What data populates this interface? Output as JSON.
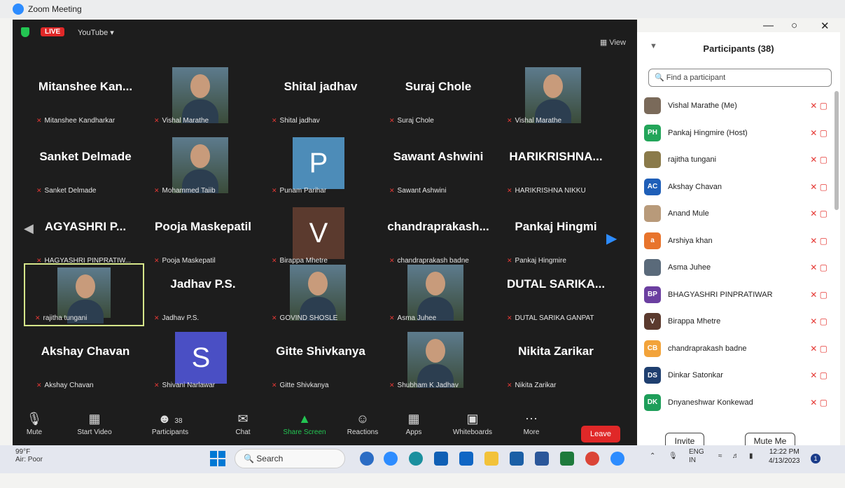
{
  "window": {
    "title": "Zoom Meeting"
  },
  "meeting_top": {
    "live_label": "LIVE",
    "platform": "YouTube",
    "view_label": "View"
  },
  "tiles": [
    {
      "big": "Mitanshee Kan...",
      "name": "Mitanshee Kandharkar"
    },
    {
      "photo": true,
      "name": "Vishal Marathe"
    },
    {
      "big": "Shital jadhav",
      "name": "Shital jadhav"
    },
    {
      "big": "Suraj Chole",
      "name": "Suraj Chole"
    },
    {
      "photo": true,
      "name": "Vishal Marathe"
    },
    {
      "big": "Sanket Delmade",
      "name": "Sanket Delmade"
    },
    {
      "photo": true,
      "name": "Mohammed Taiib"
    },
    {
      "avatar": "P",
      "avatar_color": "#4d8cb8",
      "name": "Punam Parihar"
    },
    {
      "big": "Sawant Ashwini",
      "name": "Sawant Ashwini"
    },
    {
      "big": "HARIKRISHNA...",
      "name": "HARIKRISHNA NIKKU"
    },
    {
      "big": "AGYASHRI P...",
      "name": "HAGYASHRI PINPRATIW..."
    },
    {
      "big": "Pooja Maskepatil",
      "name": "Pooja Maskepatil"
    },
    {
      "avatar": "V",
      "avatar_color": "#5b3a2e",
      "name": "Birappa Mhetre"
    },
    {
      "big": "chandraprakash...",
      "name": "chandraprakash badne"
    },
    {
      "big": "Pankaj Hingmi",
      "name": "Pankaj Hingmire"
    },
    {
      "photo": true,
      "name": "rajitha tungani",
      "active": true
    },
    {
      "big": "Jadhav P.S.",
      "name": "Jadhav P.S."
    },
    {
      "photo": true,
      "name": "GOVIND SHOSLE"
    },
    {
      "photo": true,
      "name": "Asma Juhee"
    },
    {
      "big": "DUTAL SARIKA...",
      "name": "DUTAL SARIKA GANPAT"
    },
    {
      "big": "Akshay Chavan",
      "name": "Akshay Chavan"
    },
    {
      "avatar": "S",
      "avatar_color": "#4a4fc4",
      "name": "Shivani Narlawar"
    },
    {
      "big": "Gitte Shivkanya",
      "name": "Gitte Shivkanya"
    },
    {
      "photo": true,
      "name": "Shubham K Jadhav"
    },
    {
      "big": "Nikita Zarikar",
      "name": "Nikita Zarikar"
    }
  ],
  "toolbar": {
    "mute": "Mute",
    "start_video": "Start Video",
    "participants": "Participants",
    "participants_count": "38",
    "chat": "Chat",
    "share_screen": "Share Screen",
    "reactions": "Reactions",
    "apps": "Apps",
    "whiteboards": "Whiteboards",
    "more": "More",
    "leave": "Leave"
  },
  "panel": {
    "title": "Participants (38)",
    "search_placeholder": "Find a participant",
    "participants": [
      {
        "initials": "",
        "color": "#7a6a5a",
        "name": "Vishal Marathe (Me)"
      },
      {
        "initials": "PH",
        "color": "#23a55a",
        "name": "Pankaj Hingmire (Host)"
      },
      {
        "initials": "",
        "color": "#8a7a4a",
        "name": "rajitha tungani"
      },
      {
        "initials": "AC",
        "color": "#1f5fb8",
        "name": "Akshay Chavan"
      },
      {
        "initials": "",
        "color": "#b89a7a",
        "name": "Anand Mule"
      },
      {
        "initials": "a",
        "color": "#e8742c",
        "name": "Arshiya khan"
      },
      {
        "initials": "",
        "color": "#5a6a7a",
        "name": "Asma Juhee"
      },
      {
        "initials": "BP",
        "color": "#6b3fa0",
        "name": "BHAGYASHRI PINPRATIWAR"
      },
      {
        "initials": "V",
        "color": "#5b3a2e",
        "name": "Birappa Mhetre"
      },
      {
        "initials": "CB",
        "color": "#f2a33a",
        "name": "chandraprakash badne"
      },
      {
        "initials": "DS",
        "color": "#1f3f6f",
        "name": "Dinkar Satonkar"
      },
      {
        "initials": "DK",
        "color": "#1e9e5a",
        "name": "Dnyaneshwar Konkewad"
      }
    ],
    "invite": "Invite",
    "mute_me": "Mute Me"
  },
  "taskbar": {
    "temp": "99°F",
    "air": "Air: Poor",
    "search": "Search",
    "lang1": "ENG",
    "lang2": "IN",
    "time": "12:22 PM",
    "date": "4/13/2023",
    "notif": "1"
  }
}
